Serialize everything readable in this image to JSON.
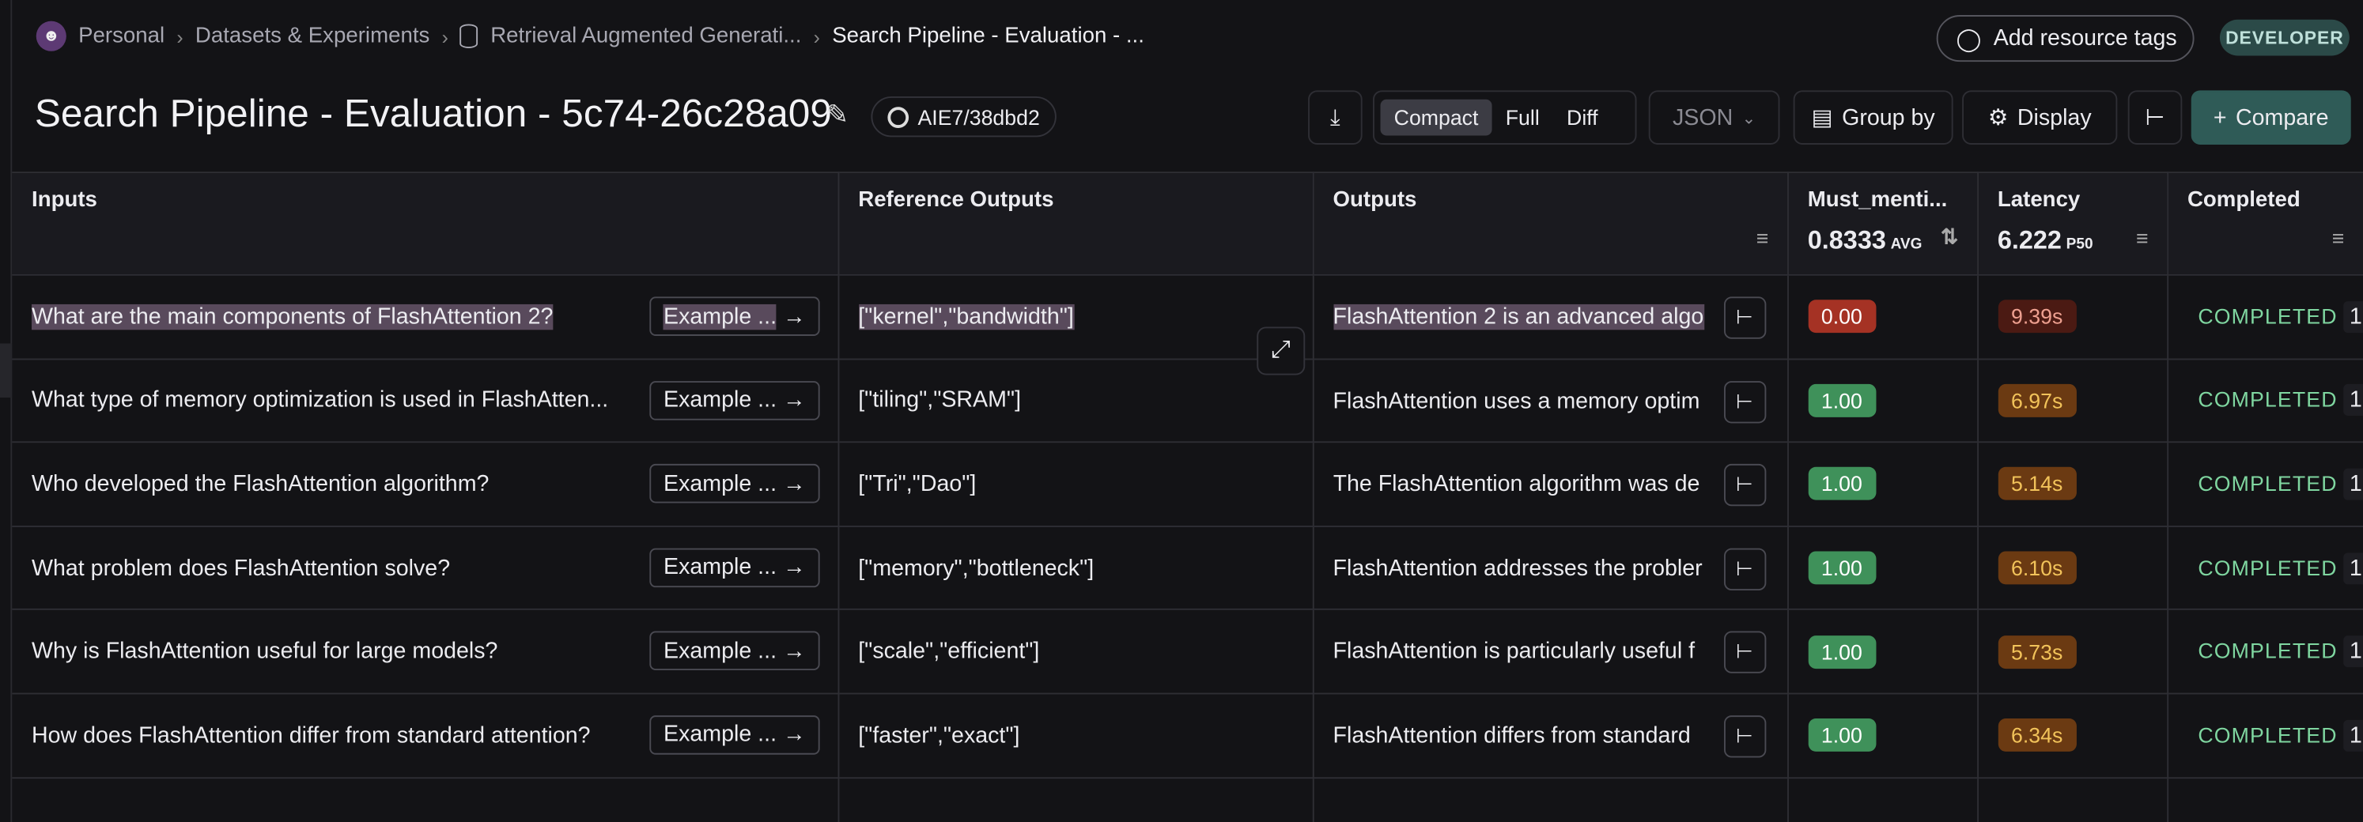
{
  "breadcrumb": [
    "Personal",
    "Datasets & Experiments",
    "Retrieval Augmented Generati...",
    "Search Pipeline - Evaluation - ..."
  ],
  "header": {
    "add_tags": "Add resource tags",
    "role_badge": "DEVELOPER",
    "title": "Search Pipeline - Evaluation - 5c74-26c28a09",
    "commit": "AIE7/38dbd2"
  },
  "toolbar": {
    "views": [
      "Compact",
      "Full",
      "Diff"
    ],
    "active_view": "Compact",
    "format": "JSON",
    "group_by": "Group by",
    "display": "Display",
    "compare": "Compare"
  },
  "columns": {
    "inputs": "Inputs",
    "reference": "Reference Outputs",
    "outputs": "Outputs",
    "must": "Must_menti...",
    "must_stat": "0.8333",
    "must_stat_label": "AVG",
    "latency": "Latency",
    "latency_stat": "6.222",
    "latency_stat_label": "P50",
    "completed": "Completed"
  },
  "example_label": "Example ...",
  "rows": [
    {
      "input": "What are the main components of FlashAttention 2?",
      "reference": "[\"kernel\",\"bandwidth\"]",
      "output": "FlashAttention 2 is an advanced algo",
      "score": "0.00",
      "latency": "9.39s",
      "status": "COMPLETED",
      "count": "1"
    },
    {
      "input": "What type of memory optimization is used in FlashAtten...",
      "reference": "[\"tiling\",\"SRAM\"]",
      "output": "FlashAttention uses a memory optim",
      "score": "1.00",
      "latency": "6.97s",
      "status": "COMPLETED",
      "count": "1"
    },
    {
      "input": "Who developed the FlashAttention algorithm?",
      "reference": "[\"Tri\",\"Dao\"]",
      "output": "The FlashAttention algorithm was de",
      "score": "1.00",
      "latency": "5.14s",
      "status": "COMPLETED",
      "count": "1"
    },
    {
      "input": "What problem does FlashAttention solve?",
      "reference": "[\"memory\",\"bottleneck\"]",
      "output": "FlashAttention addresses the probler",
      "score": "1.00",
      "latency": "6.10s",
      "status": "COMPLETED",
      "count": "1"
    },
    {
      "input": "Why is FlashAttention useful for large models?",
      "reference": "[\"scale\",\"efficient\"]",
      "output": "FlashAttention is particularly useful f",
      "score": "1.00",
      "latency": "5.73s",
      "status": "COMPLETED",
      "count": "1"
    },
    {
      "input": "How does FlashAttention differ from standard attention?",
      "reference": "[\"faster\",\"exact\"]",
      "output": "FlashAttention differs from standard",
      "score": "1.00",
      "latency": "6.34s",
      "status": "COMPLETED",
      "count": "1"
    }
  ],
  "colors": {
    "pass": "#3f915a",
    "fail": "#a53224",
    "accent": "#2f5b57"
  }
}
